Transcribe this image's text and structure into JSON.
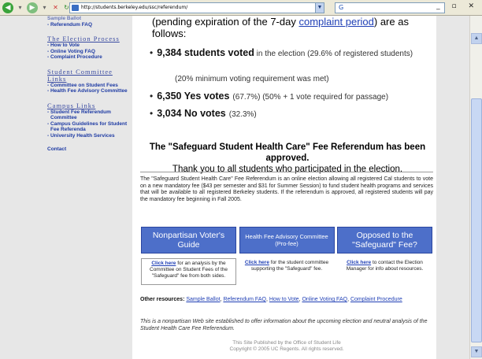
{
  "browser": {
    "address": "http://students.berkeley.edu/ssc/referendum/",
    "search_value": "G"
  },
  "sidebar": {
    "top_links": [
      "Sample Ballot",
      "- Referendum FAQ"
    ],
    "election_heading": "The Election Process",
    "election_links": [
      "- How to Vote",
      "- Online Voting FAQ",
      "- Complaint Procedure"
    ],
    "committee_heading": "Student Committee Links",
    "committee_links": [
      "- Committee on Student Fees",
      "- Health Fee Advisory Committee"
    ],
    "campus_heading": "Campus Links",
    "campus_links": [
      "- Student Fee Referendum Committee",
      "- Campus Guidelines for Student Fee Referenda",
      "- University Health Services"
    ],
    "contact": "Contact"
  },
  "results": {
    "intro_prefix": "(pending expiration of the 7-day",
    "intro_link": "complaint period",
    "intro_suffix": ") are as follows:",
    "voted_strong": "9,384 students voted",
    "voted_rest": "in the election (29.6% of registered students)",
    "min_note": "(20% minimum voting requirement was met)",
    "yes_strong": "6,350 Yes votes",
    "yes_rest": "(67.7%)  (50% + 1 vote required for passage)",
    "no_strong": "3,034 No votes",
    "no_rest": "(32.3%)"
  },
  "approved": {
    "line1": "The \"Safeguard Student Health Care\" Fee Referendum has been approved.",
    "line2": "Thank you to all students who participated in the election."
  },
  "description": "The \"Safeguard Student Health Care\" Fee Referendum is an online election allowing all registered Cal students to vote on a new mandatory fee ($43 per semester and $31 for Summer Session) to fund student health programs and services that will be available to all registered Berkeley students. If the referendum is approved, all registered students will pay the mandatory fee beginning in Fall 2005.",
  "boxes": [
    {
      "title": "Nonpartisan Voter's Guide",
      "click": "Click here",
      "body": "for an analysis by the Committee on Student Fees of the \"Safeguard\" fee from both sides."
    },
    {
      "title": "Health Fee Advisory Committee (Pro-fee)",
      "click": "Click here",
      "body": "for the student committee supporting the \"Safeguard\" fee."
    },
    {
      "title": "Opposed to the \"Safeguard\" Fee?",
      "click": "Click here",
      "body": "to contact the Election Manager for info about resources."
    }
  ],
  "other_resources": {
    "label": "Other resources:",
    "links": [
      "Sample Ballot",
      "Referendum FAQ",
      "How to Vote",
      "Online Voting FAQ",
      "Complaint Procedure"
    ]
  },
  "note": "This is a nonpartisan Web site established to offer information about the upcoming election and neutral analysis of the Student Health Care Fee Referendum.",
  "footer": {
    "line1": "This Site Published by the Office of Student Life",
    "line2": "Copyright © 2005 UC Regents. All rights reserved."
  }
}
